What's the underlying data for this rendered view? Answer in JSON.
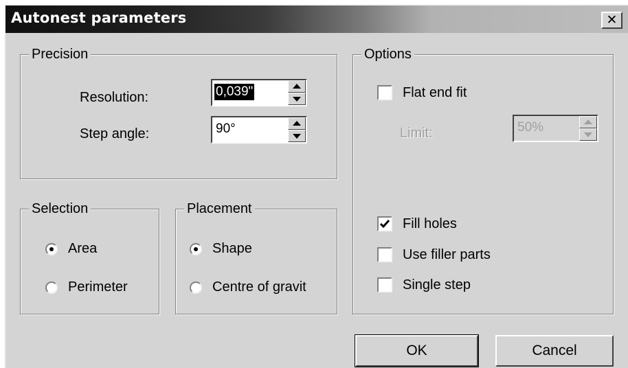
{
  "window": {
    "title": "Autonest parameters",
    "close_glyph": "✕"
  },
  "precision": {
    "legend": "Precision",
    "resolution_label": "Resolution:",
    "resolution_value": "0,039\"",
    "step_angle_label": "Step angle:",
    "step_angle_value": "90°"
  },
  "selection": {
    "legend": "Selection",
    "options": [
      {
        "label": "Area",
        "checked": true
      },
      {
        "label": "Perimeter",
        "checked": false
      }
    ]
  },
  "placement": {
    "legend": "Placement",
    "options": [
      {
        "label": "Shape",
        "checked": true
      },
      {
        "label": "Centre of gravit",
        "checked": false
      }
    ]
  },
  "options": {
    "legend": "Options",
    "flat_end_fit": {
      "label": "Flat end fit",
      "checked": false
    },
    "limit_label": "Limit:",
    "limit_value": "50%",
    "fill_holes": {
      "label": "Fill holes",
      "checked": true
    },
    "use_filler_parts": {
      "label": "Use filler parts",
      "checked": false
    },
    "single_step": {
      "label": "Single step",
      "checked": false
    }
  },
  "buttons": {
    "ok": "OK",
    "cancel": "Cancel"
  }
}
